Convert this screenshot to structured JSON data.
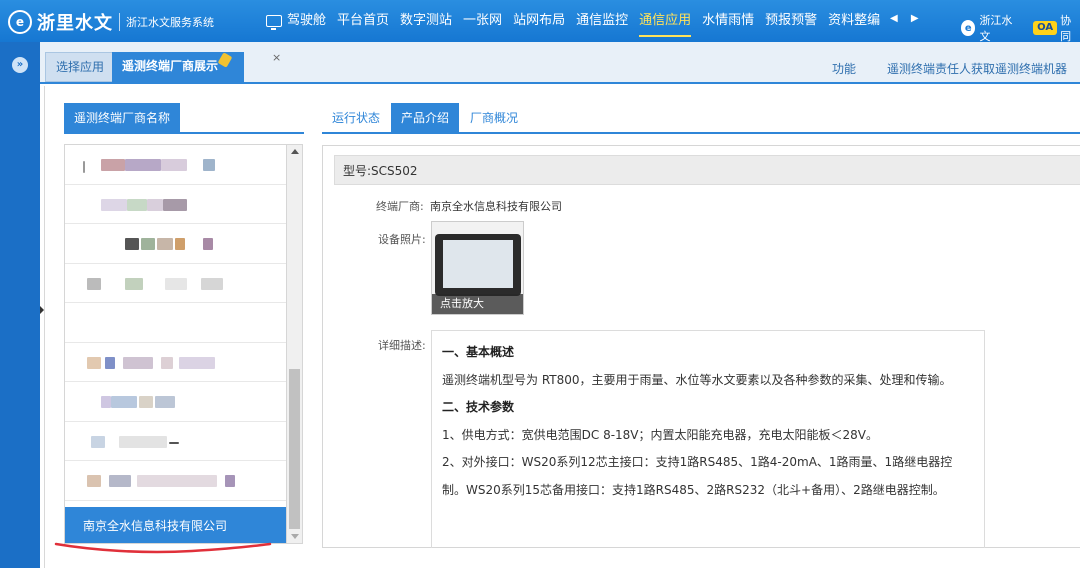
{
  "topbar": {
    "logo_mark": "e",
    "logo_text": "浙里水文",
    "logo_sub": "浙江水文服务系统",
    "nav": [
      {
        "label": "驾驶舱"
      },
      {
        "label": "平台首页"
      },
      {
        "label": "数字测站"
      },
      {
        "label": "一张网"
      },
      {
        "label": "站网布局"
      },
      {
        "label": "通信监控"
      },
      {
        "label": "通信应用"
      },
      {
        "label": "水情雨情"
      },
      {
        "label": "预报预警"
      },
      {
        "label": "资料整编"
      }
    ],
    "active_nav": "通信应用",
    "prev_arrow": "◀",
    "next_arrow": "▶",
    "user_icon_glyph": "e",
    "user_label": "浙江水文",
    "oa_label": "OA",
    "oa_text": "协同"
  },
  "left_strip": {
    "toggle_glyph": "»"
  },
  "tabbar": {
    "tabs": [
      {
        "label": "选择应用"
      },
      {
        "label": "遥测终端厂商展示"
      }
    ],
    "close_glyph": "×",
    "func_link": "功能",
    "marquee": "遥测终端责任人获取遥测终端机器"
  },
  "left_panel": {
    "header": "遥测终端厂商名称",
    "selected_item": "南京全水信息科技有限公司"
  },
  "right_panel": {
    "tabs": [
      {
        "label": "运行状态"
      },
      {
        "label": "产品介绍"
      },
      {
        "label": "厂商概况"
      }
    ],
    "active_tab": "产品介绍",
    "model_label": "型号:SCS502",
    "vendor_label": "终端厂商:",
    "vendor_value": "南京全水信息科技有限公司",
    "photo_label": "设备照片:",
    "photo_zoom": "点击放大",
    "desc_label": "详细描述:",
    "description": {
      "h1": "一、基本概述",
      "p1": "遥测终端机型号为 RT800，主要用于雨量、水位等水文要素以及各种参数的采集、处理和传输。",
      "h2": "二、技术参数",
      "p2": "1、供电方式：宽供电范围DC 8-18V；内置太阳能充电器，充电太阳能板＜28V。",
      "p3": "2、对外接口：WS20系列12芯主接口：支持1路RS485、1路4-20mA、1路雨量、1路继电器控制。WS20系列15芯备用接口：支持1路RS485、2路RS232（北斗+备用）、2路继电器控制。"
    }
  },
  "colors": {
    "primary": "#2f86d8",
    "topbar": "#1677d2",
    "active_nav": "#ffe25a",
    "annotation_red": "#e0303a"
  }
}
